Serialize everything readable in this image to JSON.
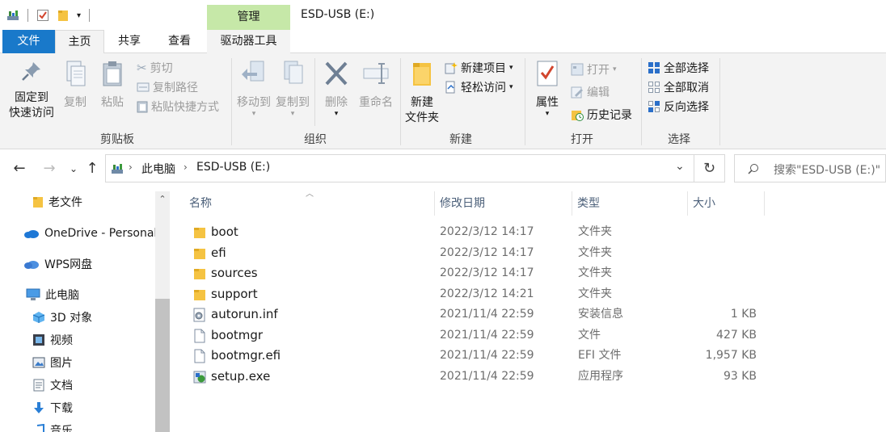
{
  "window": {
    "context_group_label": "管理",
    "title": "ESD-USB (E:)"
  },
  "tabs": {
    "file": "文件",
    "home": "主页",
    "share": "共享",
    "view": "查看",
    "drive_tools": "驱动器工具"
  },
  "ribbon": {
    "clipboard": {
      "label": "剪贴板",
      "pin_line1": "固定到",
      "pin_line2": "快速访问",
      "copy": "复制",
      "paste": "粘贴",
      "cut": "剪切",
      "copy_path": "复制路径",
      "paste_shortcut": "粘贴快捷方式"
    },
    "organize": {
      "label": "组织",
      "move_to": "移动到",
      "copy_to": "复制到",
      "delete": "删除",
      "rename": "重命名"
    },
    "new": {
      "label": "新建",
      "new_folder_line1": "新建",
      "new_folder_line2": "文件夹",
      "new_item": "新建项目",
      "easy_access": "轻松访问"
    },
    "open": {
      "label": "打开",
      "properties": "属性",
      "open": "打开",
      "edit": "编辑",
      "history": "历史记录"
    },
    "select": {
      "label": "选择",
      "select_all": "全部选择",
      "select_none": "全部取消",
      "invert": "反向选择"
    }
  },
  "address": {
    "crumb1": "此电脑",
    "crumb2": "ESD-USB (E:)",
    "search_placeholder": "搜索\"ESD-USB (E:)\""
  },
  "navpane": {
    "items": [
      {
        "label": "老文件",
        "icon": "folder-icon"
      },
      {
        "label": "OneDrive - Personal",
        "icon": "onedrive-icon"
      },
      {
        "label": "WPS网盘",
        "icon": "wps-cloud-icon"
      },
      {
        "label": "此电脑",
        "icon": "this-pc-icon"
      },
      {
        "label": "3D 对象",
        "icon": "3d-objects-icon"
      },
      {
        "label": "视频",
        "icon": "video-icon"
      },
      {
        "label": "图片",
        "icon": "pictures-icon"
      },
      {
        "label": "文档",
        "icon": "documents-icon"
      },
      {
        "label": "下载",
        "icon": "downloads-icon"
      },
      {
        "label": "音乐",
        "icon": "music-icon"
      }
    ]
  },
  "columns": {
    "name": "名称",
    "date": "修改日期",
    "type": "类型",
    "size": "大小"
  },
  "files": [
    {
      "name": "boot",
      "date": "2022/3/12 14:17",
      "type": "文件夹",
      "size": "",
      "icon": "folder-icon"
    },
    {
      "name": "efi",
      "date": "2022/3/12 14:17",
      "type": "文件夹",
      "size": "",
      "icon": "folder-icon"
    },
    {
      "name": "sources",
      "date": "2022/3/12 14:17",
      "type": "文件夹",
      "size": "",
      "icon": "folder-icon"
    },
    {
      "name": "support",
      "date": "2022/3/12 14:21",
      "type": "文件夹",
      "size": "",
      "icon": "folder-icon"
    },
    {
      "name": "autorun.inf",
      "date": "2021/11/4 22:59",
      "type": "安装信息",
      "size": "1 KB",
      "icon": "setup-info-icon"
    },
    {
      "name": "bootmgr",
      "date": "2021/11/4 22:59",
      "type": "文件",
      "size": "427 KB",
      "icon": "file-icon"
    },
    {
      "name": "bootmgr.efi",
      "date": "2021/11/4 22:59",
      "type": "EFI 文件",
      "size": "1,957 KB",
      "icon": "file-icon"
    },
    {
      "name": "setup.exe",
      "date": "2021/11/4 22:59",
      "type": "应用程序",
      "size": "93 KB",
      "icon": "setup-exe-icon"
    }
  ],
  "colors": {
    "file_tab": "#1979ca",
    "context_tab": "#c6e8a8",
    "folder": "#f5c342",
    "accent_blue": "#1979ca"
  }
}
